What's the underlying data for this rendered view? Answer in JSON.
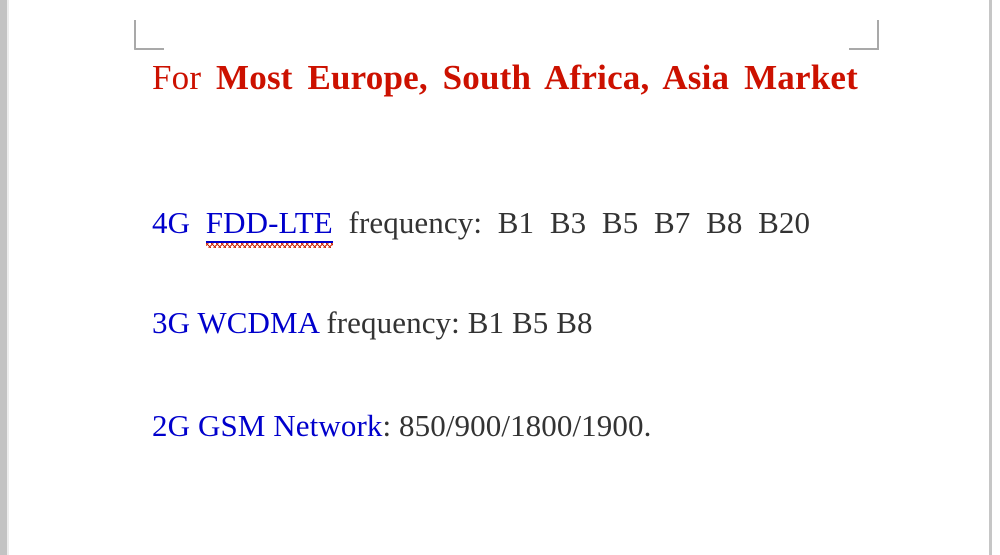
{
  "document": {
    "heading": {
      "lead_word": "For",
      "bold_text": "Most Europe, South Africa, Asia Market",
      "full_text": "For Most Europe, South Africa, Asia Market",
      "color": "#cc1100"
    },
    "specs": [
      {
        "id": "4g",
        "tech_label": "4G",
        "standard": "FDD-LTE",
        "standard_misspelled": true,
        "label": "frequency:",
        "bands_text": "B1  B3  B5  B7  B8  B20",
        "bands": [
          "B1",
          "B3",
          "B5",
          "B7",
          "B8",
          "B20"
        ],
        "tech_color": "#0000cc",
        "value_color": "#333333"
      },
      {
        "id": "3g",
        "tech_label": "3G",
        "standard": "WCDMA",
        "standard_misspelled": false,
        "label": "frequency:",
        "bands_text": "B1 B5 B8",
        "bands": [
          "B1",
          "B5",
          "B8"
        ],
        "tech_color": "#0000cc",
        "value_color": "#333333"
      },
      {
        "id": "2g",
        "tech_label": "2G",
        "standard": "GSM Network",
        "standard_misspelled": false,
        "label": ":",
        "bands_text": "850/900/1800/1900.",
        "bands": [
          "850",
          "900",
          "1800",
          "1900"
        ],
        "tech_color": "#0000cc",
        "value_color": "#333333"
      }
    ],
    "spacing": {
      "gap_4g_tech": "  ",
      "gap_before_bands": "  ",
      "gap_single": " "
    }
  }
}
